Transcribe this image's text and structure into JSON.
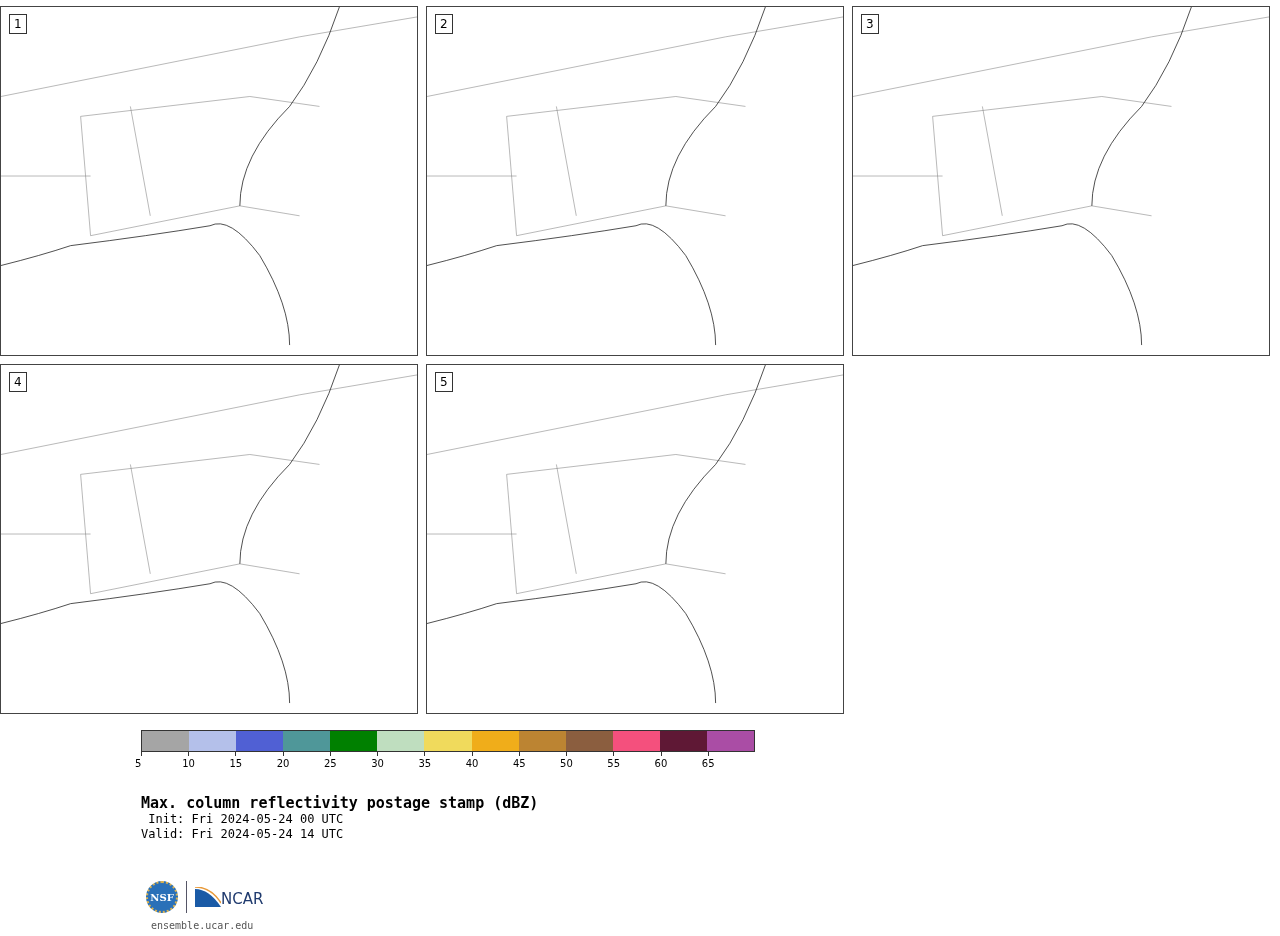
{
  "panels": [
    {
      "label": "1"
    },
    {
      "label": "2"
    },
    {
      "label": "3"
    },
    {
      "label": "4"
    },
    {
      "label": "5"
    }
  ],
  "colorbar": {
    "swatches": [
      {
        "color": "#a5a5a5"
      },
      {
        "color": "#b4c0ea"
      },
      {
        "color": "#5060d4"
      },
      {
        "color": "#4f9799"
      },
      {
        "color": "#008000"
      },
      {
        "color": "#bfdebf"
      },
      {
        "color": "#f0da5c"
      },
      {
        "color": "#f0ad1a"
      },
      {
        "color": "#bc8432"
      },
      {
        "color": "#8b5e3f"
      },
      {
        "color": "#f4507d"
      },
      {
        "color": "#5f1835"
      },
      {
        "color": "#aa4da5"
      }
    ],
    "ticks": [
      "5",
      "10",
      "15",
      "20",
      "25",
      "30",
      "35",
      "40",
      "45",
      "50",
      "55",
      "60",
      "65"
    ]
  },
  "title": "Max. column reflectivity postage stamp (dBZ)",
  "init": " Init: Fri 2024-05-24 00 UTC",
  "valid": "Valid: Fri 2024-05-24 14 UTC",
  "logos": {
    "nsf": "NSF",
    "ncar": "NCAR"
  },
  "url": "ensemble.ucar.edu"
}
